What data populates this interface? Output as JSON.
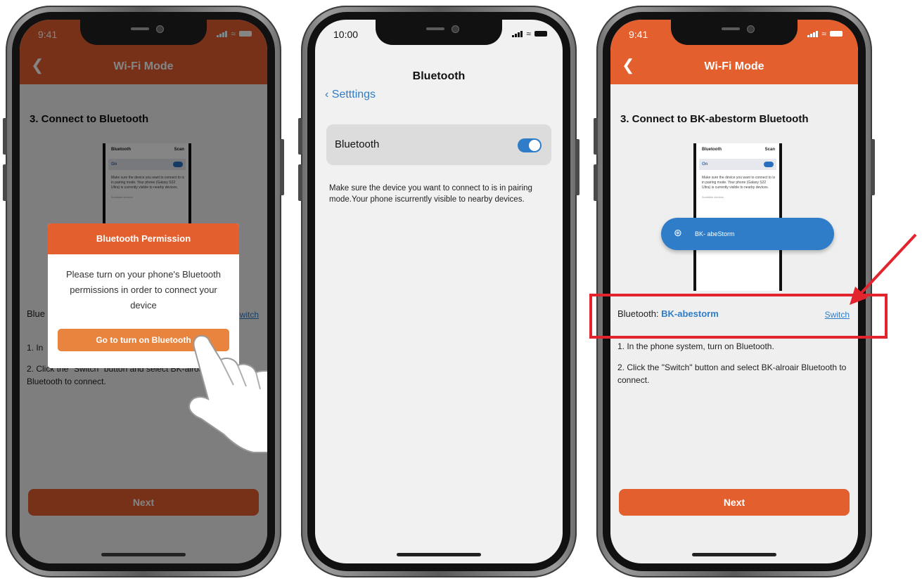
{
  "colors": {
    "accent": "#e35f2e",
    "link": "#2f7dc8",
    "highlight": "#e3232e"
  },
  "phone1": {
    "status_time": "9:41",
    "nav_title": "Wi-Fi Mode",
    "step_title": "3.  Connect to Bluetooth",
    "mini": {
      "title": "Bluetooth",
      "scan": "Scan",
      "on": "On",
      "text": "Make sure the device you want to connect to is in pairing mode. Your phone (Galaxy S22 Ultra) is currently visible to nearby devices.",
      "available": "Available devices"
    },
    "bt_prefix": "Blue",
    "switch_label": "witch",
    "instr1": "1. In",
    "instr2": "2. Click the \"Switch\" button and select BK-alroair",
    "instr2b": "Bluetooth to connect.",
    "next_label": "Next",
    "dialog": {
      "title": "Bluetooth Permission",
      "body": "Please turn on your phone's Bluetooth permissions in order to connect your device",
      "button": "Go to turn on Bluetooth"
    }
  },
  "phone2": {
    "status_time": "10:00",
    "title": "Bluetooth",
    "back": "Setttings",
    "toggle_label": "Bluetooth",
    "toggle_on": true,
    "note": "Make sure the device you want to connect to is in pairing mode.Your phone iscurrently visible to nearby devices."
  },
  "phone3": {
    "status_time": "9:41",
    "nav_title": "Wi-Fi Mode",
    "step_title": "3.  Connect to BK-abestorm Bluetooth",
    "mini": {
      "title": "Bluetooth",
      "scan": "Scan",
      "on": "On",
      "text": "Make sure the device you want to connect to is in pairing mode. Your phone (Galaxy S22 Ultra) is currently visible to nearby devices.",
      "available": "Available devices"
    },
    "device_label": "BK- abeStorm",
    "bt_label": "Bluetooth: ",
    "bt_name": "BK-abestorm",
    "switch_label": "Switch",
    "instr1": "1. In the phone system, turn on Bluetooth.",
    "instr2": "2. Click the \"Switch\" button and select BK-alroair Bluetooth to connect.",
    "next_label": "Next"
  }
}
